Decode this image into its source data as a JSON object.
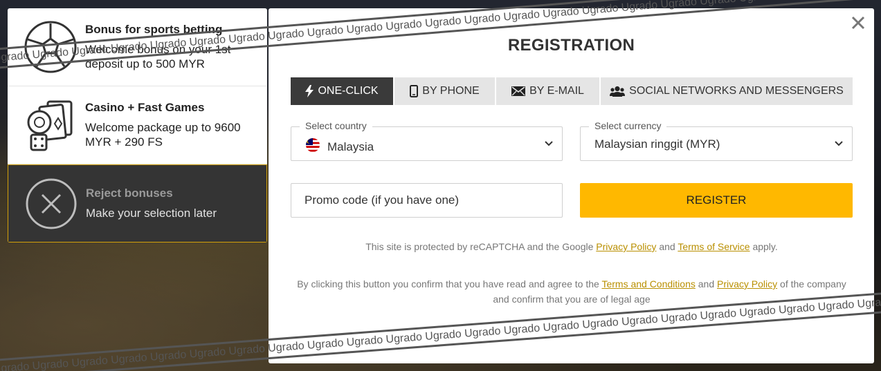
{
  "bonus_panel": {
    "options": [
      {
        "title": "Bonus for sports betting",
        "description": "Welcome bonus on your 1st deposit up to 500 MYR"
      },
      {
        "title": "Casino + Fast Games",
        "description": "Welcome package up to 9600 MYR + 290 FS"
      },
      {
        "title": "Reject bonuses",
        "description": "Make your selection later"
      }
    ]
  },
  "modal": {
    "title": "REGISTRATION",
    "tabs": [
      {
        "label": "ONE-CLICK",
        "icon": "lightning-icon"
      },
      {
        "label": "BY PHONE",
        "icon": "phone-icon"
      },
      {
        "label": "BY E-MAIL",
        "icon": "envelope-icon"
      },
      {
        "label": "SOCIAL NETWORKS AND MESSENGERS",
        "icon": "users-icon"
      }
    ],
    "country": {
      "label": "Select country",
      "value": "Malaysia",
      "flag": "malaysia-flag"
    },
    "currency": {
      "label": "Select currency",
      "value": "Malaysian ringgit (MYR)"
    },
    "promo": {
      "placeholder": "Promo code (if you have one)"
    },
    "register_label": "REGISTER",
    "recaptcha": {
      "prefix": "This site is protected by reCAPTCHA and the Google",
      "privacy": "Privacy Policy",
      "and": "and",
      "terms": "Terms of Service",
      "suffix": "apply."
    },
    "consent": {
      "prefix": "By clicking this button you confirm that you have read and agree to the",
      "terms": "Terms and Conditions",
      "and": "and",
      "privacy": "Privacy Policy",
      "suffix": "of the company and confirm that you are of legal age"
    }
  },
  "watermark": "Ugrado Ugrado Ugrado Ugrado Ugrado Ugrado Ugrado Ugrado Ugrado Ugrado Ugrado Ugrado Ugrado Ugrado Ugrado Ugrado Ugrado Ugrado Ugrado Ugrado Ugrado Ugrado Ugrado Ugrado",
  "colors": {
    "accent": "#ffb800",
    "link": "#b98f00",
    "active_tab": "#3a3a3a"
  }
}
